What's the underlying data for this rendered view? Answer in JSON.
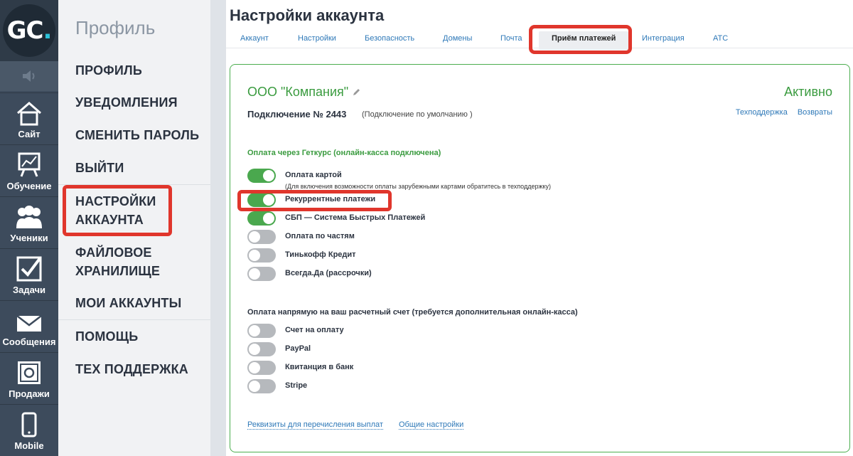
{
  "logo": {
    "text_main": "GC",
    "text_dot": "."
  },
  "rail": [
    {
      "label": "Сайт",
      "icon": "house-icon"
    },
    {
      "label": "Обучение",
      "icon": "chart-board-icon"
    },
    {
      "label": "Ученики",
      "icon": "people-icon"
    },
    {
      "label": "Задачи",
      "icon": "checkbox-icon"
    },
    {
      "label": "Сообщения",
      "icon": "envelope-icon"
    },
    {
      "label": "Продажи",
      "icon": "safe-icon"
    },
    {
      "label": "Mobile",
      "icon": "phone-icon"
    }
  ],
  "menu": {
    "title": "Профиль",
    "items": [
      "ПРОФИЛЬ",
      "УВЕДОМЛЕНИЯ",
      "СМЕНИТЬ ПАРОЛЬ",
      "ВЫЙТИ",
      "НАСТРОЙКИ АККАУНТА",
      "ФАЙЛОВОЕ ХРАНИЛИЩЕ",
      "МОИ АККАУНТЫ",
      "ПОМОЩЬ",
      "ТЕХ ПОДДЕРЖКА"
    ]
  },
  "page": {
    "title": "Настройки аккаунта",
    "tabs": [
      "Аккаунт",
      "Настройки",
      "Безопасность",
      "Домены",
      "Почта",
      "Приём платежей",
      "Интеграция",
      "АТС"
    ],
    "active_tab": "Приём платежей"
  },
  "card": {
    "company": "ООО \"Компания\"",
    "status": "Активно",
    "connection": "Подключение № 2443",
    "connection_note": "(Подключение по умолчанию )",
    "link_support": "Техподдержка",
    "link_returns": "Возвраты",
    "section1_title": "Оплата через Геткурс (онлайн-касса подключена)",
    "section1_rows": [
      {
        "label": "Оплата картой",
        "on": true,
        "sub": "(Для включения возможности оплаты зарубежными картами обратитесь в техподдержку)"
      },
      {
        "label": "Рекуррентные платежи",
        "on": true,
        "sub": ""
      },
      {
        "label": "СБП — Система Быстрых Платежей",
        "on": true,
        "sub": ""
      },
      {
        "label": "Оплата по частям",
        "on": false,
        "sub": ""
      },
      {
        "label": "Тинькофф Кредит",
        "on": false,
        "sub": ""
      },
      {
        "label": "Всегда.Да (рассрочки)",
        "on": false,
        "sub": ""
      }
    ],
    "section2_title": "Оплата напрямую на ваш расчетный счет (требуется дополнительная онлайн-касса)",
    "section2_rows": [
      {
        "label": "Счет на оплату",
        "on": false
      },
      {
        "label": "PayPal",
        "on": false
      },
      {
        "label": "Квитанция в банк",
        "on": false
      },
      {
        "label": "Stripe",
        "on": false
      }
    ],
    "footer_link1": "Реквизиты для перечисления выплат",
    "footer_link2": "Общие настройки"
  },
  "colors": {
    "accent_green": "#4aa84e",
    "highlight_red": "#e0362c",
    "link_blue": "#2f79b8",
    "rail_bg": "#3d4b5c"
  }
}
